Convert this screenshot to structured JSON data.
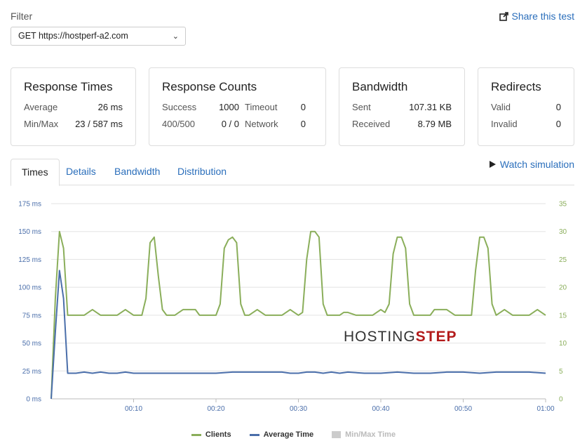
{
  "filter": {
    "label": "Filter",
    "selected": "GET https://hostperf-a2.com",
    "share_label": "Share this test"
  },
  "cards": {
    "response_times": {
      "title": "Response Times",
      "average_label": "Average",
      "average_value": "26 ms",
      "minmax_label": "Min/Max",
      "minmax_value": "23 / 587 ms"
    },
    "response_counts": {
      "title": "Response Counts",
      "success_label": "Success",
      "success_value": "1000",
      "timeout_label": "Timeout",
      "timeout_value": "0",
      "err_label": "400/500",
      "err_value": "0 / 0",
      "network_label": "Network",
      "network_value": "0"
    },
    "bandwidth": {
      "title": "Bandwidth",
      "sent_label": "Sent",
      "sent_value": "107.31 KB",
      "received_label": "Received",
      "received_value": "8.79 MB"
    },
    "redirects": {
      "title": "Redirects",
      "valid_label": "Valid",
      "valid_value": "0",
      "invalid_label": "Invalid",
      "invalid_value": "0"
    }
  },
  "tabs": [
    "Times",
    "Details",
    "Bandwidth",
    "Distribution"
  ],
  "watch_label": "Watch simulation",
  "watermark": {
    "prefix": "HOSTING",
    "suffix": "STEP"
  },
  "colors": {
    "clients": "#8aae5a",
    "average": "#4a6eaa",
    "minmax": "#cccccc",
    "link": "#2a6ebb"
  },
  "chart_data": {
    "type": "line",
    "x_ticks": [
      "00:10",
      "00:20",
      "00:30",
      "00:40",
      "00:50",
      "01:00"
    ],
    "y_left_ticks": [
      "0 ms",
      "25 ms",
      "50 ms",
      "75 ms",
      "100 ms",
      "125 ms",
      "150 ms",
      "175 ms"
    ],
    "y_right_ticks": [
      "0",
      "5",
      "10",
      "15",
      "20",
      "25",
      "30",
      "35"
    ],
    "ylim_left": [
      0,
      175
    ],
    "ylim_right": [
      0,
      35
    ],
    "xlim": [
      0,
      60
    ],
    "series": [
      {
        "name": "Clients",
        "axis": "right",
        "points": [
          [
            0,
            0
          ],
          [
            0.5,
            18
          ],
          [
            1,
            30
          ],
          [
            1.5,
            27
          ],
          [
            2,
            15
          ],
          [
            3,
            15
          ],
          [
            4,
            15
          ],
          [
            4.5,
            15.5
          ],
          [
            5,
            16
          ],
          [
            5.5,
            15.5
          ],
          [
            6,
            15
          ],
          [
            7,
            15
          ],
          [
            8,
            15
          ],
          [
            8.5,
            15.5
          ],
          [
            9,
            16
          ],
          [
            9.5,
            15.5
          ],
          [
            10,
            15
          ],
          [
            11,
            15
          ],
          [
            11.5,
            18
          ],
          [
            12,
            28
          ],
          [
            12.5,
            29
          ],
          [
            13,
            22
          ],
          [
            13.5,
            16
          ],
          [
            14,
            15
          ],
          [
            15,
            15
          ],
          [
            15.5,
            15.5
          ],
          [
            16,
            16
          ],
          [
            17,
            16
          ],
          [
            17.5,
            16
          ],
          [
            18,
            15
          ],
          [
            19,
            15
          ],
          [
            20,
            15
          ],
          [
            20.5,
            17
          ],
          [
            21,
            27
          ],
          [
            21.5,
            28.5
          ],
          [
            22,
            29
          ],
          [
            22.5,
            28
          ],
          [
            23,
            17
          ],
          [
            23.5,
            15
          ],
          [
            24,
            15
          ],
          [
            24.5,
            15.5
          ],
          [
            25,
            16
          ],
          [
            25.5,
            15.5
          ],
          [
            26,
            15
          ],
          [
            27,
            15
          ],
          [
            28,
            15
          ],
          [
            28.5,
            15.5
          ],
          [
            29,
            16
          ],
          [
            29.5,
            15.5
          ],
          [
            30,
            15
          ],
          [
            30.5,
            15.5
          ],
          [
            31,
            25
          ],
          [
            31.5,
            30
          ],
          [
            32,
            30
          ],
          [
            32.5,
            29
          ],
          [
            33,
            17
          ],
          [
            33.5,
            15
          ],
          [
            34,
            15
          ],
          [
            35,
            15
          ],
          [
            35.5,
            15.5
          ],
          [
            36,
            15.5
          ],
          [
            37,
            15
          ],
          [
            38,
            15
          ],
          [
            39,
            15
          ],
          [
            39.5,
            15.5
          ],
          [
            40,
            16
          ],
          [
            40.5,
            15.5
          ],
          [
            41,
            17
          ],
          [
            41.5,
            26
          ],
          [
            42,
            29
          ],
          [
            42.5,
            29
          ],
          [
            43,
            27
          ],
          [
            43.5,
            17
          ],
          [
            44,
            15
          ],
          [
            45,
            15
          ],
          [
            46,
            15
          ],
          [
            46.5,
            16
          ],
          [
            47,
            16
          ],
          [
            48,
            16
          ],
          [
            48.5,
            15.5
          ],
          [
            49,
            15
          ],
          [
            50,
            15
          ],
          [
            51,
            15
          ],
          [
            51.5,
            23
          ],
          [
            52,
            29
          ],
          [
            52.5,
            29
          ],
          [
            53,
            27
          ],
          [
            53.5,
            17
          ],
          [
            54,
            15
          ],
          [
            54.5,
            15.5
          ],
          [
            55,
            16
          ],
          [
            55.5,
            15.5
          ],
          [
            56,
            15
          ],
          [
            57,
            15
          ],
          [
            58,
            15
          ],
          [
            58.5,
            15.5
          ],
          [
            59,
            16
          ],
          [
            59.5,
            15.5
          ],
          [
            60,
            15
          ],
          [
            61,
            15
          ]
        ]
      },
      {
        "name": "Average Time",
        "axis": "left",
        "points": [
          [
            0,
            0
          ],
          [
            0.5,
            60
          ],
          [
            1,
            115
          ],
          [
            1.5,
            90
          ],
          [
            2,
            23
          ],
          [
            3,
            23
          ],
          [
            4,
            24
          ],
          [
            5,
            23
          ],
          [
            6,
            24
          ],
          [
            7,
            23
          ],
          [
            8,
            23
          ],
          [
            9,
            24
          ],
          [
            10,
            23
          ],
          [
            12,
            23
          ],
          [
            14,
            23
          ],
          [
            16,
            23
          ],
          [
            18,
            23
          ],
          [
            20,
            23
          ],
          [
            22,
            24
          ],
          [
            24,
            24
          ],
          [
            26,
            24
          ],
          [
            28,
            24
          ],
          [
            29,
            23
          ],
          [
            30,
            23
          ],
          [
            31,
            24
          ],
          [
            32,
            24
          ],
          [
            33,
            23
          ],
          [
            34,
            24
          ],
          [
            35,
            23
          ],
          [
            36,
            24
          ],
          [
            38,
            23
          ],
          [
            40,
            23
          ],
          [
            42,
            24
          ],
          [
            44,
            23
          ],
          [
            46,
            23
          ],
          [
            48,
            24
          ],
          [
            50,
            24
          ],
          [
            52,
            23
          ],
          [
            54,
            24
          ],
          [
            56,
            24
          ],
          [
            58,
            24
          ],
          [
            60,
            23
          ],
          [
            61,
            23
          ]
        ]
      },
      {
        "name": "Min/Max Time",
        "axis": "left",
        "points": []
      }
    ]
  }
}
